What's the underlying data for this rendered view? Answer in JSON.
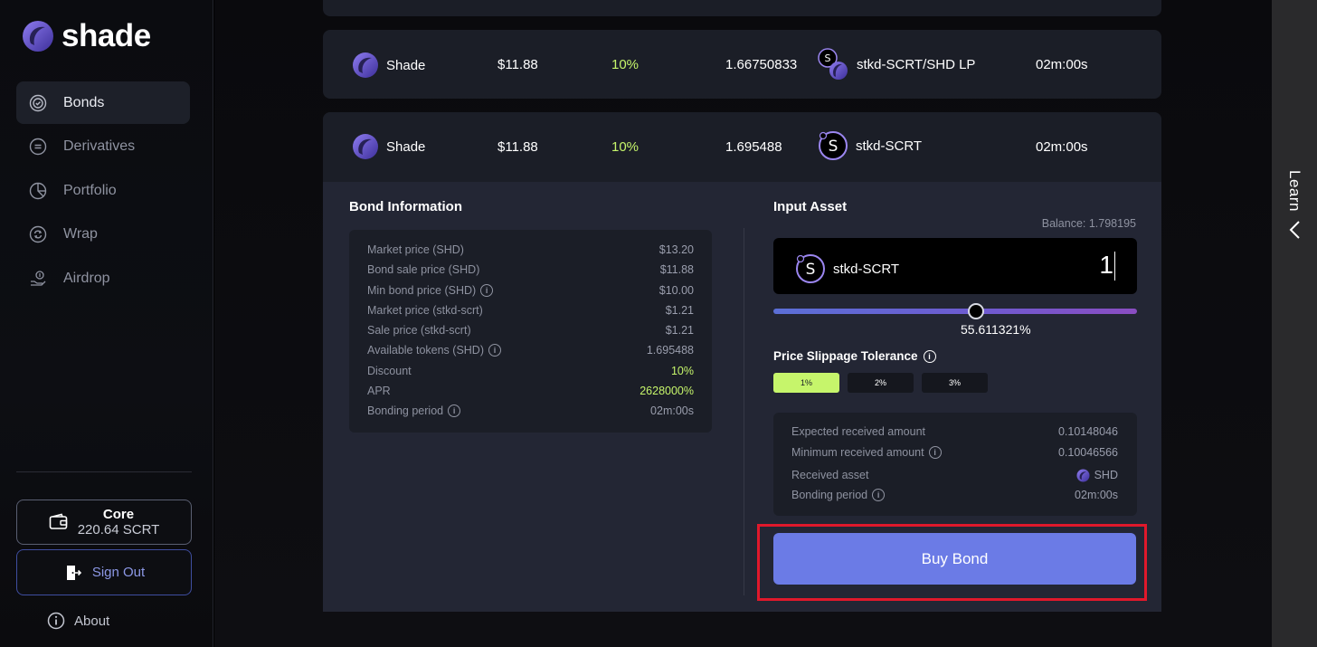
{
  "app": {
    "logo_text": "shade"
  },
  "sidebar": {
    "items": [
      {
        "label": "Bonds",
        "icon": "bonds-icon",
        "active": true
      },
      {
        "label": "Derivatives",
        "icon": "derivatives-icon",
        "active": false
      },
      {
        "label": "Portfolio",
        "icon": "portfolio-icon",
        "active": false
      },
      {
        "label": "Wrap",
        "icon": "wrap-icon",
        "active": false
      },
      {
        "label": "Airdrop",
        "icon": "airdrop-icon",
        "active": false
      }
    ],
    "wallet": {
      "name": "Core",
      "balance": "220.64 SCRT"
    },
    "sign_out_label": "Sign Out",
    "about_label": "About"
  },
  "bonds": [
    {
      "name": "Shade",
      "price": "$11.88",
      "discount": "10%",
      "amount": "1.66750833",
      "asset": "stkd-SCRT/SHD LP",
      "period": "02m:00s"
    },
    {
      "name": "Shade",
      "price": "$11.88",
      "discount": "10%",
      "amount": "1.695488",
      "asset": "stkd-SCRT",
      "period": "02m:00s"
    }
  ],
  "bond_information": {
    "title": "Bond Information",
    "rows": [
      {
        "label": "Market price (SHD)",
        "value": "$13.20",
        "info": false
      },
      {
        "label": "Bond sale price (SHD)",
        "value": "$11.88",
        "info": false
      },
      {
        "label": "Min bond price (SHD)",
        "value": "$10.00",
        "info": true
      },
      {
        "label": "Market price (stkd-scrt)",
        "value": "$1.21",
        "info": false
      },
      {
        "label": "Sale price (stkd-scrt)",
        "value": "$1.21",
        "info": false
      },
      {
        "label": "Available tokens (SHD)",
        "value": "1.695488",
        "info": true
      },
      {
        "label": "Discount",
        "value": "10%",
        "info": false,
        "highlight": true
      },
      {
        "label": "APR",
        "value": "2628000%",
        "info": false,
        "highlight": true
      },
      {
        "label": "Bonding period",
        "value": "02m:00s",
        "info": true
      }
    ]
  },
  "input_asset": {
    "title": "Input Asset",
    "balance": "Balance: 1.798195",
    "token": "stkd-SCRT",
    "value": "1",
    "slider_percent_label": "55.611321%",
    "slider_fraction": 0.556
  },
  "slippage": {
    "title": "Price Slippage Tolerance",
    "options": [
      "1%",
      "2%",
      "3%"
    ],
    "selected": "1%"
  },
  "receive": {
    "rows": [
      {
        "label": "Expected received amount",
        "value": "0.10148046",
        "info": false
      },
      {
        "label": "Minimum received amount",
        "value": "0.10046566",
        "info": true
      },
      {
        "label": "Received asset",
        "value": "SHD",
        "info": false,
        "token": true
      },
      {
        "label": "Bonding period",
        "value": "02m:00s",
        "info": true
      }
    ]
  },
  "buy_button_label": "Buy Bond",
  "learn_label": "Learn",
  "colors": {
    "accent": "#6b7be6",
    "highlight_green": "#c6f56b",
    "annotation_red": "#e0182b"
  }
}
